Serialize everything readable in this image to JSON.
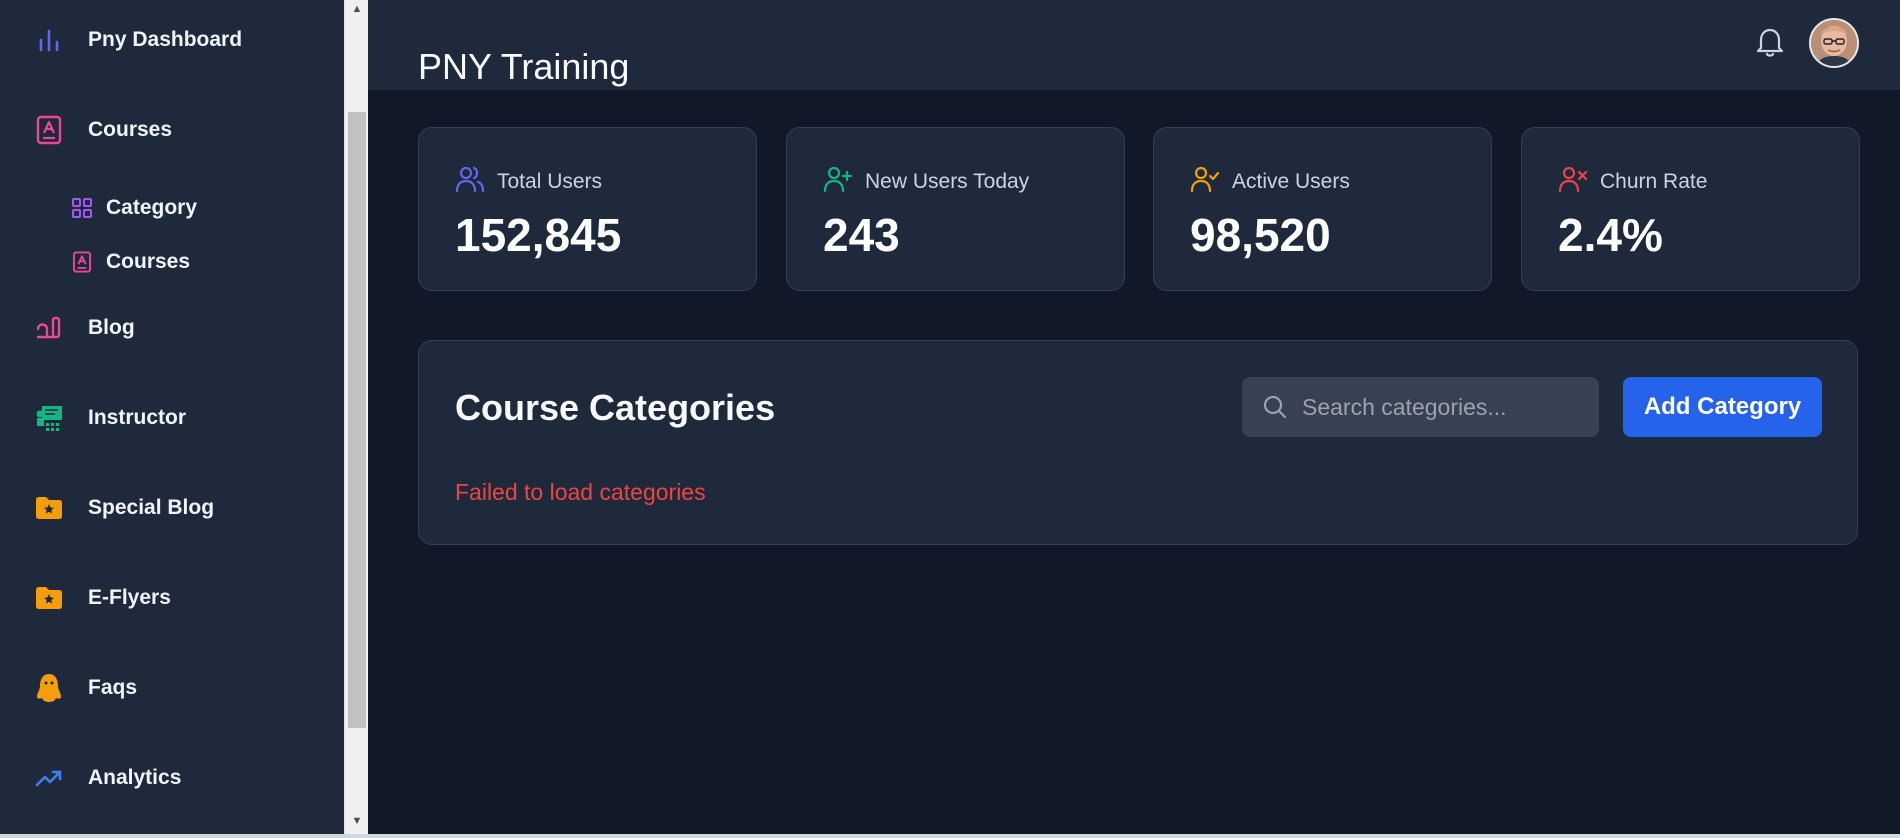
{
  "sidebar": {
    "items": [
      {
        "label": "Pny Dashboard",
        "icon": "bar-chart-icon"
      },
      {
        "label": "Courses",
        "icon": "book-icon"
      },
      {
        "label": "Category",
        "icon": "grid-icon"
      },
      {
        "label": "Courses",
        "icon": "book-icon"
      },
      {
        "label": "Blog",
        "icon": "blog-icon"
      },
      {
        "label": "Instructor",
        "icon": "instructor-icon"
      },
      {
        "label": "Special Blog",
        "icon": "star-folder-icon"
      },
      {
        "label": "E-Flyers",
        "icon": "star-folder-icon"
      },
      {
        "label": "Faqs",
        "icon": "penguin-icon"
      },
      {
        "label": "Analytics",
        "icon": "trending-up-icon"
      }
    ]
  },
  "header": {
    "title": "PNY Training",
    "notification_icon": "bell-icon",
    "avatar_icon": "user-avatar"
  },
  "stats": [
    {
      "label": "Total Users",
      "value": "152,845",
      "icon": "users-icon",
      "color": "#6366f1"
    },
    {
      "label": "New Users Today",
      "value": "243",
      "icon": "user-plus-icon",
      "color": "#10b981"
    },
    {
      "label": "Active Users",
      "value": "98,520",
      "icon": "user-check-icon",
      "color": "#f59e0b"
    },
    {
      "label": "Churn Rate",
      "value": "2.4%",
      "icon": "user-x-icon",
      "color": "#ef4444"
    }
  ],
  "categories": {
    "title": "Course Categories",
    "search_placeholder": "Search categories...",
    "search_value": "",
    "add_button": "Add Category",
    "error": "Failed to load categories"
  },
  "colors": {
    "background": "#111827",
    "surface": "#1e293b",
    "accent": "#2563eb",
    "error": "#ef4444"
  }
}
